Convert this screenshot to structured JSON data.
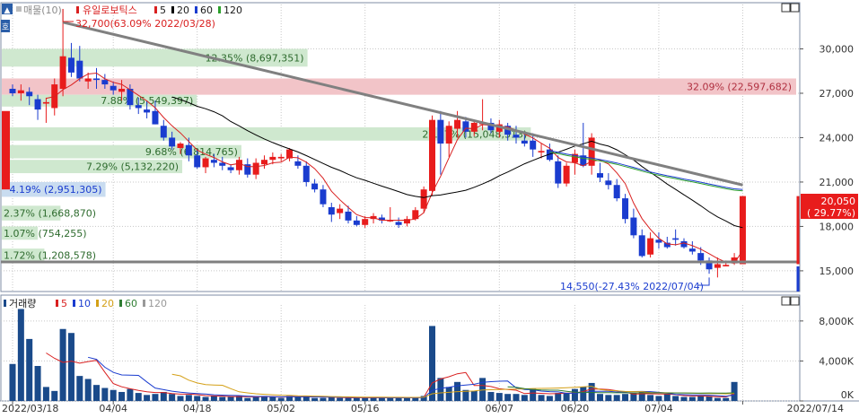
{
  "price_panel": {
    "legend": {
      "icon_label": "▲",
      "volume_profile": "매물(10)",
      "stock_name": "유일로보틱스",
      "ma_items": [
        {
          "label": "5",
          "color": "#d92020"
        },
        {
          "label": "20",
          "color": "#000000"
        },
        {
          "label": "60",
          "color": "#1a3ccf"
        },
        {
          "label": "120",
          "color": "#2ca02c"
        }
      ]
    },
    "side_tab": "호",
    "window_buttons": [
      "▫",
      "▫"
    ],
    "high_annotation": "32,700(63.09% 2022/03/28)",
    "low_annotation": "14,550(-27.43% 2022/07/04)",
    "current_price": "20,050",
    "current_change": "( 29.77%)"
  },
  "volume_panel": {
    "legend": {
      "title": "거래량",
      "ma_items": [
        {
          "label": "5",
          "color": "#d92020"
        },
        {
          "label": "10",
          "color": "#1a3ccf"
        },
        {
          "label": "20",
          "color": "#d4a017"
        },
        {
          "label": "60",
          "color": "#2e7d32"
        },
        {
          "label": "120",
          "color": "#999999"
        }
      ]
    },
    "window_buttons": [
      "▫",
      "▫"
    ]
  },
  "chart_data": [
    {
      "type": "candlestick",
      "y_ticks": [
        "30,000",
        "27,000",
        "24,000",
        "21,000",
        "18,000",
        "15,000"
      ],
      "y_tick_values": [
        30000,
        27000,
        24000,
        21000,
        18000,
        15000
      ],
      "ylim": [
        13600,
        33000
      ],
      "x_labels": [
        "2022/03/18",
        "04/04",
        "04/18",
        "05/02",
        "05/16",
        "06/07",
        "06/20",
        "07/04",
        "2022/07/14"
      ],
      "x_label_index": [
        0,
        12,
        22,
        32,
        42,
        58,
        67,
        77,
        87
      ],
      "candles": [
        [
          27300,
          27600,
          26800,
          27000
        ],
        [
          27000,
          27600,
          26500,
          27200
        ],
        [
          27100,
          27400,
          26200,
          26800
        ],
        [
          26600,
          26900,
          25200,
          25900
        ],
        [
          26300,
          26700,
          25000,
          26400
        ],
        [
          26000,
          28000,
          25500,
          27600
        ],
        [
          27300,
          32700,
          26800,
          29500
        ],
        [
          29400,
          30400,
          28100,
          28400
        ],
        [
          29200,
          30200,
          27800,
          28000
        ],
        [
          27800,
          28400,
          27300,
          28000
        ],
        [
          28000,
          28700,
          27300,
          27900
        ],
        [
          27900,
          28300,
          27300,
          27600
        ],
        [
          27500,
          27800,
          26900,
          27200
        ],
        [
          27100,
          27900,
          26500,
          27300
        ],
        [
          27300,
          27600,
          25900,
          26200
        ],
        [
          26200,
          26700,
          25600,
          26000
        ],
        [
          25900,
          26500,
          25300,
          25700
        ],
        [
          25800,
          26500,
          24900,
          24900
        ],
        [
          24800,
          25200,
          23800,
          24000
        ],
        [
          24000,
          24400,
          23200,
          23400
        ],
        [
          23300,
          23700,
          22900,
          23600
        ],
        [
          23500,
          24000,
          22400,
          22800
        ],
        [
          22800,
          23200,
          21900,
          22000
        ],
        [
          22000,
          22700,
          21600,
          22600
        ],
        [
          22500,
          22900,
          22000,
          22300
        ],
        [
          22300,
          22700,
          21800,
          22100
        ],
        [
          22000,
          22200,
          21600,
          21800
        ],
        [
          21800,
          22700,
          21500,
          22500
        ],
        [
          22200,
          22600,
          21300,
          21500
        ],
        [
          21500,
          22600,
          21200,
          22300
        ],
        [
          22200,
          22800,
          21900,
          22500
        ],
        [
          22500,
          23000,
          22200,
          22700
        ],
        [
          22600,
          22900,
          22400,
          22700
        ],
        [
          22600,
          23300,
          22400,
          23200
        ],
        [
          22400,
          22800,
          21900,
          22100
        ],
        [
          22100,
          22400,
          20700,
          21000
        ],
        [
          20900,
          21200,
          20300,
          20500
        ],
        [
          20500,
          20800,
          19300,
          19500
        ],
        [
          19300,
          19600,
          18300,
          18800
        ],
        [
          18900,
          19500,
          18500,
          19200
        ],
        [
          19000,
          19400,
          18200,
          18400
        ],
        [
          18400,
          18700,
          18000,
          18100
        ],
        [
          18100,
          18700,
          17900,
          18500
        ],
        [
          18500,
          18900,
          18200,
          18700
        ],
        [
          18600,
          18800,
          18200,
          18400
        ],
        [
          18400,
          19300,
          18300,
          18400
        ],
        [
          18300,
          18600,
          17900,
          18100
        ],
        [
          18200,
          18700,
          18000,
          18500
        ],
        [
          18500,
          19300,
          18400,
          19100
        ],
        [
          19200,
          20700,
          18900,
          20500
        ],
        [
          20400,
          25500,
          20100,
          25200
        ],
        [
          25200,
          25800,
          21500,
          23600
        ],
        [
          23600,
          25100,
          22700,
          24800
        ],
        [
          24600,
          25800,
          24000,
          25200
        ],
        [
          25100,
          25400,
          24000,
          24400
        ],
        [
          24400,
          25100,
          24100,
          25000
        ],
        [
          24900,
          26600,
          24500,
          25000
        ],
        [
          25000,
          25300,
          24300,
          24500
        ],
        [
          24400,
          25200,
          24000,
          24900
        ],
        [
          24800,
          25000,
          23800,
          24200
        ],
        [
          24200,
          24800,
          23600,
          24000
        ],
        [
          23800,
          24300,
          23400,
          23600
        ],
        [
          23800,
          24300,
          22700,
          23200
        ],
        [
          23000,
          23600,
          22600,
          23100
        ],
        [
          23200,
          23600,
          22400,
          22500
        ],
        [
          22400,
          22800,
          20600,
          20900
        ],
        [
          20900,
          22300,
          20700,
          22100
        ],
        [
          22300,
          23200,
          21500,
          22900
        ],
        [
          22800,
          25000,
          22000,
          22100
        ],
        [
          22100,
          24300,
          21500,
          24000
        ],
        [
          21600,
          22300,
          21000,
          21300
        ],
        [
          21100,
          21600,
          20500,
          20800
        ],
        [
          20800,
          21200,
          19700,
          19900
        ],
        [
          19900,
          20200,
          18200,
          18500
        ],
        [
          18600,
          19200,
          17200,
          17400
        ],
        [
          17400,
          17800,
          15900,
          16000
        ],
        [
          16100,
          17600,
          15900,
          17200
        ],
        [
          17100,
          17600,
          16500,
          16900
        ],
        [
          16900,
          17300,
          16500,
          16600
        ],
        [
          17200,
          17800,
          16700,
          17100
        ],
        [
          17000,
          17200,
          16500,
          16600
        ],
        [
          16500,
          17000,
          16100,
          16300
        ],
        [
          16200,
          16600,
          15400,
          15700
        ],
        [
          15700,
          15900,
          14800,
          15100
        ],
        [
          15200,
          15900,
          14550,
          15450
        ],
        [
          15300,
          15700,
          15300,
          15400
        ],
        [
          15500,
          16200,
          15400,
          15900
        ],
        [
          15450,
          20050,
          15450,
          20050
        ]
      ],
      "volume_profile": [
        {
          "price_low": 26900,
          "price_high": 28000,
          "pct": "32.09%",
          "volume": "(22,597,682)",
          "color": "#f2c4c8"
        },
        {
          "price_low": 28800,
          "price_high": 30000,
          "pct": "12.35%",
          "volume": "(8,697,351)",
          "color": "#cfe8cf"
        },
        {
          "price_low": 26100,
          "price_high": 26900,
          "pct": "7.88%",
          "volume": "(5,549,397)",
          "color": "#cfe8cf"
        },
        {
          "price_low": 23800,
          "price_high": 24700,
          "pct": "21.37%",
          "volume": "(15,048,313)",
          "color": "#cfe8cf"
        },
        {
          "price_low": 22600,
          "price_high": 23500,
          "pct": "9.68%",
          "volume": "(6,814,765)",
          "color": "#cfe8cf"
        },
        {
          "price_low": 21600,
          "price_high": 22500,
          "pct": "7.29%",
          "volume": "(5,132,220)",
          "color": "#cfe8cf"
        },
        {
          "price_low": 20000,
          "price_high": 21000,
          "pct": "4.19%",
          "volume": "(2,951,305)",
          "color": "#c9dcf0"
        },
        {
          "price_low": 18400,
          "price_high": 19400,
          "pct": "2.37%",
          "volume": "(1,668,870)",
          "color": "#cfe8cf"
        },
        {
          "price_low": 17100,
          "price_high": 18000,
          "pct": "1.07%",
          "volume": "(754,255)",
          "color": "#cfe8cf"
        },
        {
          "price_low": 15600,
          "price_high": 16500,
          "pct": "1.72%",
          "volume": "(1,208,578)",
          "color": "#cfe8cf"
        }
      ],
      "trendline": {
        "start": [
          6,
          31800
        ],
        "end": [
          87,
          20800
        ]
      },
      "support_price": 15600,
      "prior_day_bar": {
        "index": 0,
        "open": 25800,
        "close": 20500
      }
    },
    {
      "type": "bar",
      "y_ticks": [
        "8,000K",
        "4,000K",
        "0K"
      ],
      "y_tick_values": [
        8000,
        4000,
        0
      ],
      "ylim": [
        0,
        9600
      ],
      "unit": "K",
      "volumes": [
        3700,
        9200,
        6200,
        3500,
        1400,
        1000,
        7200,
        6800,
        2500,
        2200,
        1600,
        1300,
        1100,
        900,
        1200,
        800,
        600,
        700,
        900,
        700,
        500,
        600,
        500,
        400,
        500,
        400,
        400,
        500,
        300,
        400,
        500,
        400,
        300,
        500,
        400,
        500,
        300,
        300,
        400,
        300,
        300,
        300,
        300,
        400,
        300,
        300,
        300,
        300,
        400,
        500,
        7500,
        2300,
        1400,
        1900,
        1100,
        1000,
        2300,
        900,
        800,
        700,
        700,
        600,
        1200,
        600,
        500,
        800,
        800,
        1200,
        1400,
        1800,
        700,
        600,
        600,
        700,
        800,
        900,
        600,
        500,
        700,
        500,
        400,
        400,
        500,
        500,
        300,
        300,
        1900
      ],
      "volume_colors": "#1a4a8a",
      "last_bar_color": "#1a4a8a"
    }
  ]
}
